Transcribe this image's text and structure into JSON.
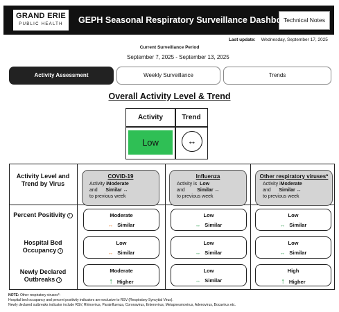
{
  "header": {
    "logo_line1": "GRAND ERIE",
    "logo_line2": "PUBLIC HEALTH",
    "title": "GEPH Seasonal Respiratory Surveillance Dashboard",
    "tech_notes_label": "Technical Notes"
  },
  "last_update": {
    "label": "Last update:",
    "value": "Wednesday, September 17, 2025"
  },
  "period": {
    "label": "Current Surveillance Period",
    "value": "September 7, 2025 -  September 13, 2025"
  },
  "tabs": [
    {
      "label": "Activity Assessment",
      "active": true
    },
    {
      "label": "Weekly Surveillance",
      "active": false
    },
    {
      "label": "Trends",
      "active": false
    }
  ],
  "overall": {
    "title": "Overall Activity Level & Trend",
    "activity_header": "Activity",
    "trend_header": "Trend",
    "level": "Low",
    "level_color": "#2fbf55",
    "trend_symbol": "↔"
  },
  "grid": {
    "header_label": "Activity Level and Trend by Virus",
    "viruses": [
      {
        "name": "COVID-19",
        "activity_prefix": "Activity i",
        "level": "Moderate",
        "and": "and",
        "trend_word": "Similar",
        "trend_symbol": "↔",
        "suffix": "to previous week"
      },
      {
        "name": "Influenza",
        "activity_prefix": "Activity is",
        "level": "Low",
        "and": "and",
        "trend_word": "Similar",
        "trend_symbol": "↔",
        "suffix": "to previous week"
      },
      {
        "name": "Other respiratory viruses*",
        "activity_prefix": "Activity i",
        "level": "Moderate",
        "and": "and",
        "trend_word": "Similar",
        "trend_symbol": "↔",
        "suffix": "to previous week"
      }
    ],
    "rows": [
      {
        "label": "Percent Positivity",
        "cells": [
          {
            "level": "Moderate",
            "arrow": "↔",
            "arrow_color": "#e47a2b",
            "trend": "Similar"
          },
          {
            "level": "Low",
            "arrow": "↔",
            "arrow_color": "#2e9c4e",
            "trend": "Similar"
          },
          {
            "level": "Low",
            "arrow": "↔",
            "arrow_color": "#2e9c4e",
            "trend": "Similar"
          }
        ]
      },
      {
        "label": "Hospital Bed Occupancy",
        "cells": [
          {
            "level": "Low",
            "arrow": "↔",
            "arrow_color": "#e47a2b",
            "trend": "Similar"
          },
          {
            "level": "Low",
            "arrow": "↔",
            "arrow_color": "#2e9c4e",
            "trend": "Similar"
          },
          {
            "level": "Low",
            "arrow": "↔",
            "arrow_color": "#2e9c4e",
            "trend": "Similar"
          }
        ]
      },
      {
        "label": "Newly Declared Outbreaks",
        "cells": [
          {
            "level": "Moderate",
            "arrow": "↑",
            "arrow_color": "#2e9c4e",
            "trend": "Higher"
          },
          {
            "level": "Low",
            "arrow": "↔",
            "arrow_color": "#2e9c4e",
            "trend": "Similar"
          },
          {
            "level": "High",
            "arrow": "↑",
            "arrow_color": "#2e9c4e",
            "trend": "Higher"
          }
        ]
      }
    ]
  },
  "notes": {
    "label": "NOTE:",
    "line1": "Other respiratory viruses*:",
    "line2": "Hospital bed occupancy and percent positivity indicators are exclusive to RSV (Respiratory Syncytial Virus).",
    "line3": "Newly declared outbreaks indicator include RSV, Rhinovirus, Parainfluenza, Coronavirus, Enterovirus, Metapneumovirus, Adenovirus, Bocavirus etc."
  }
}
